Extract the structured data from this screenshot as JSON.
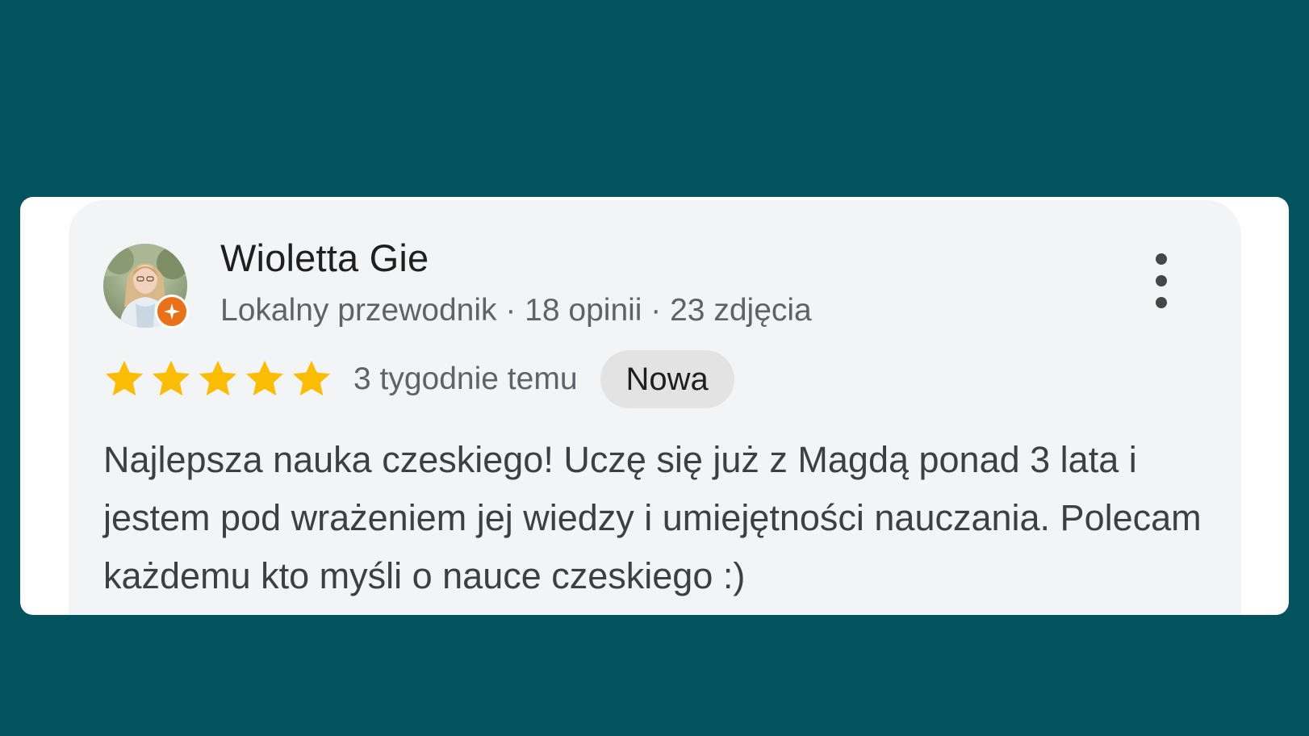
{
  "review": {
    "author_name": "Wioletta Gie",
    "author_meta": "Lokalny przewodnik · 18 opinii · 23 zdjęcia",
    "avatar_icon": "user-photo",
    "badge_icon": "local-guide-star-icon",
    "rating": 5,
    "rating_max": 5,
    "time_ago": "3 tygodnie temu",
    "new_badge": "Nowa",
    "text": "Najlepsza nauka czeskiego! Uczę się już z Magdą ponad 3 lata i jestem pod wrażeniem jej wiedzy i umiejętności nauczania. Polecam każdemu kto myśli o nauce czeskiego :)",
    "more_icon": "more-vert-icon"
  },
  "colors": {
    "background": "#02535e",
    "card": "#f3f4f6",
    "star": "#fbbc04",
    "badge_orange": "#e8711a",
    "name": "#1f1f1f",
    "secondary": "#5f6368"
  }
}
